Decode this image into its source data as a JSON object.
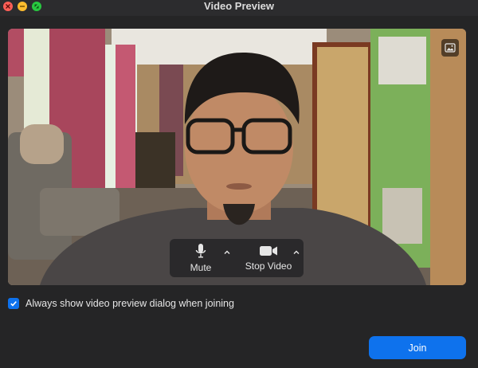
{
  "window": {
    "title": "Video Preview"
  },
  "controls": {
    "mute_label": "Mute",
    "stop_video_label": "Stop Video"
  },
  "options": {
    "always_show_label": "Always show video preview dialog when joining",
    "always_show_checked": true
  },
  "actions": {
    "join_label": "Join"
  },
  "icons": {
    "close": "close-icon",
    "minimize": "minimize-icon",
    "maximize": "maximize-icon",
    "pip": "picture-icon",
    "mic": "microphone-icon",
    "camera": "video-camera-icon",
    "chevron": "chevron-up-icon",
    "check": "checkmark-icon"
  },
  "colors": {
    "accent": "#0e72ed",
    "background": "#252526",
    "titlebar": "#2c2c2e"
  }
}
